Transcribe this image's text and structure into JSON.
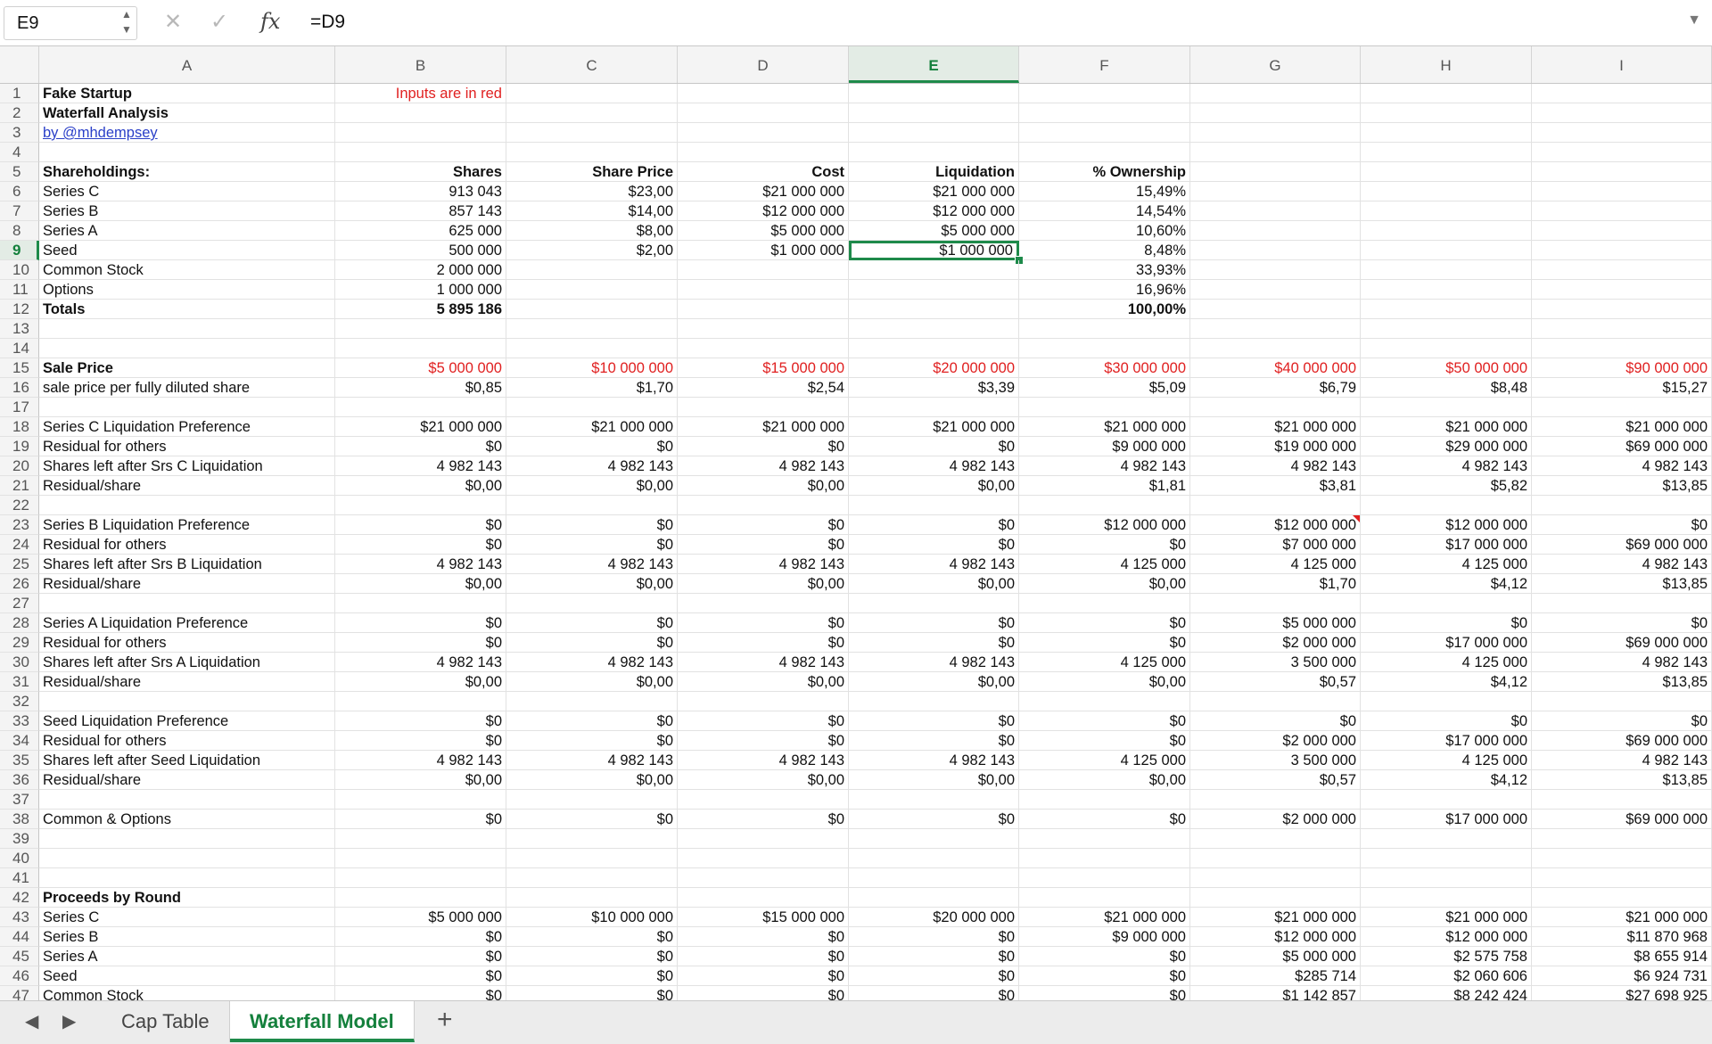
{
  "formula_bar": {
    "name_box": "E9",
    "formula": "=D9",
    "cancel_icon": "close-icon",
    "confirm_icon": "check-icon",
    "function_icon": "fx-icon"
  },
  "columns": [
    "A",
    "B",
    "C",
    "D",
    "E",
    "F",
    "G",
    "H",
    "I"
  ],
  "selected_column": "E",
  "selected_row": "9",
  "colors": {
    "accent": "#1e8a4a",
    "input_red": "#e02020",
    "link_blue": "#2a3fc8"
  },
  "rows": [
    {
      "n": "1",
      "A": "Fake Startup",
      "A_style": "bold",
      "B": "Inputs are in red",
      "B_style": "red"
    },
    {
      "n": "2",
      "A": "Waterfall Analysis",
      "A_style": "bold"
    },
    {
      "n": "3",
      "A": "by @mhdempsey",
      "A_style": "link"
    },
    {
      "n": "4"
    },
    {
      "n": "5",
      "A": "Shareholdings:",
      "A_style": "bold",
      "B": "Shares",
      "B_style": "bold",
      "C": "Share Price",
      "C_style": "bold",
      "D": "Cost",
      "D_style": "bold",
      "E": "Liquidation",
      "E_style": "bold",
      "F": "% Ownership",
      "F_style": "bold"
    },
    {
      "n": "6",
      "A": "Series C",
      "B": "913 043",
      "C": "$23,00",
      "D": "$21 000 000",
      "E": "$21 000 000",
      "F": "15,49%"
    },
    {
      "n": "7",
      "A": "Series B",
      "B": "857 143",
      "C": "$14,00",
      "D": "$12 000 000",
      "E": "$12 000 000",
      "F": "14,54%"
    },
    {
      "n": "8",
      "A": "Series A",
      "B": "625 000",
      "C": "$8,00",
      "D": "$5 000 000",
      "E": "$5 000 000",
      "F": "10,60%"
    },
    {
      "n": "9",
      "A": "Seed",
      "B": "500 000",
      "C": "$2,00",
      "D": "$1 000 000",
      "E": "$1 000 000",
      "F": "8,48%"
    },
    {
      "n": "10",
      "A": "Common Stock",
      "B": "2 000 000",
      "F": "33,93%"
    },
    {
      "n": "11",
      "A": "Options",
      "B": "1 000 000",
      "F": "16,96%"
    },
    {
      "n": "12",
      "A": "Totals",
      "A_style": "bold",
      "B": "5 895 186",
      "B_style": "bold",
      "F": "100,00%",
      "F_style": "bold"
    },
    {
      "n": "13"
    },
    {
      "n": "14"
    },
    {
      "n": "15",
      "A": "Sale Price",
      "A_style": "bold",
      "B": "$5 000 000",
      "C": "$10 000 000",
      "D": "$15 000 000",
      "E": "$20 000 000",
      "F": "$30 000 000",
      "G": "$40 000 000",
      "H": "$50 000 000",
      "I": "$90 000 000",
      "num_style": "red"
    },
    {
      "n": "16",
      "A": "sale price per fully diluted share",
      "B": "$0,85",
      "C": "$1,70",
      "D": "$2,54",
      "E": "$3,39",
      "F": "$5,09",
      "G": "$6,79",
      "H": "$8,48",
      "I": "$15,27"
    },
    {
      "n": "17"
    },
    {
      "n": "18",
      "A": "Series C Liquidation Preference",
      "B": "$21 000 000",
      "C": "$21 000 000",
      "D": "$21 000 000",
      "E": "$21 000 000",
      "F": "$21 000 000",
      "G": "$21 000 000",
      "H": "$21 000 000",
      "I": "$21 000 000"
    },
    {
      "n": "19",
      "A": "Residual for others",
      "B": "$0",
      "C": "$0",
      "D": "$0",
      "E": "$0",
      "F": "$9 000 000",
      "G": "$19 000 000",
      "H": "$29 000 000",
      "I": "$69 000 000"
    },
    {
      "n": "20",
      "A": "Shares left after Srs C Liquidation",
      "B": "4 982 143",
      "C": "4 982 143",
      "D": "4 982 143",
      "E": "4 982 143",
      "F": "4 982 143",
      "G": "4 982 143",
      "H": "4 982 143",
      "I": "4 982 143"
    },
    {
      "n": "21",
      "A": "Residual/share",
      "B": "$0,00",
      "C": "$0,00",
      "D": "$0,00",
      "E": "$0,00",
      "F": "$1,81",
      "G": "$3,81",
      "H": "$5,82",
      "I": "$13,85"
    },
    {
      "n": "22"
    },
    {
      "n": "23",
      "A": "Series B Liquidation Preference",
      "B": "$0",
      "C": "$0",
      "D": "$0",
      "E": "$0",
      "F": "$12 000 000",
      "G": "$12 000 000",
      "H": "$12 000 000",
      "I": "$0",
      "comment": "G"
    },
    {
      "n": "24",
      "A": "Residual for others",
      "B": "$0",
      "C": "$0",
      "D": "$0",
      "E": "$0",
      "F": "$0",
      "G": "$7 000 000",
      "H": "$17 000 000",
      "I": "$69 000 000"
    },
    {
      "n": "25",
      "A": "Shares left after Srs B Liquidation",
      "B": "4 982 143",
      "C": "4 982 143",
      "D": "4 982 143",
      "E": "4 982 143",
      "F": "4 125 000",
      "G": "4 125 000",
      "H": "4 125 000",
      "I": "4 982 143"
    },
    {
      "n": "26",
      "A": "Residual/share",
      "B": "$0,00",
      "C": "$0,00",
      "D": "$0,00",
      "E": "$0,00",
      "F": "$0,00",
      "G": "$1,70",
      "H": "$4,12",
      "I": "$13,85"
    },
    {
      "n": "27"
    },
    {
      "n": "28",
      "A": "Series A Liquidation Preference",
      "B": "$0",
      "C": "$0",
      "D": "$0",
      "E": "$0",
      "F": "$0",
      "G": "$5 000 000",
      "H": "$0",
      "I": "$0"
    },
    {
      "n": "29",
      "A": "Residual for others",
      "B": "$0",
      "C": "$0",
      "D": "$0",
      "E": "$0",
      "F": "$0",
      "G": "$2 000 000",
      "H": "$17 000 000",
      "I": "$69 000 000"
    },
    {
      "n": "30",
      "A": "Shares left after Srs A Liquidation",
      "B": "4 982 143",
      "C": "4 982 143",
      "D": "4 982 143",
      "E": "4 982 143",
      "F": "4 125 000",
      "G": "3 500 000",
      "H": "4 125 000",
      "I": "4 982 143"
    },
    {
      "n": "31",
      "A": "Residual/share",
      "B": "$0,00",
      "C": "$0,00",
      "D": "$0,00",
      "E": "$0,00",
      "F": "$0,00",
      "G": "$0,57",
      "H": "$4,12",
      "I": "$13,85"
    },
    {
      "n": "32"
    },
    {
      "n": "33",
      "A": "Seed Liquidation Preference",
      "B": "$0",
      "C": "$0",
      "D": "$0",
      "E": "$0",
      "F": "$0",
      "G": "$0",
      "H": "$0",
      "I": "$0"
    },
    {
      "n": "34",
      "A": "Residual for others",
      "B": "$0",
      "C": "$0",
      "D": "$0",
      "E": "$0",
      "F": "$0",
      "G": "$2 000 000",
      "H": "$17 000 000",
      "I": "$69 000 000"
    },
    {
      "n": "35",
      "A": "Shares left after Seed Liquidation",
      "B": "4 982 143",
      "C": "4 982 143",
      "D": "4 982 143",
      "E": "4 982 143",
      "F": "4 125 000",
      "G": "3 500 000",
      "H": "4 125 000",
      "I": "4 982 143"
    },
    {
      "n": "36",
      "A": "Residual/share",
      "B": "$0,00",
      "C": "$0,00",
      "D": "$0,00",
      "E": "$0,00",
      "F": "$0,00",
      "G": "$0,57",
      "H": "$4,12",
      "I": "$13,85"
    },
    {
      "n": "37"
    },
    {
      "n": "38",
      "A": "Common & Options",
      "B": "$0",
      "C": "$0",
      "D": "$0",
      "E": "$0",
      "F": "$0",
      "G": "$2 000 000",
      "H": "$17 000 000",
      "I": "$69 000 000"
    },
    {
      "n": "39"
    },
    {
      "n": "40"
    },
    {
      "n": "41"
    },
    {
      "n": "42",
      "A": "Proceeds by Round",
      "A_style": "bold"
    },
    {
      "n": "43",
      "A": "Series C",
      "B": "$5 000 000",
      "C": "$10 000 000",
      "D": "$15 000 000",
      "E": "$20 000 000",
      "F": "$21 000 000",
      "G": "$21 000 000",
      "H": "$21 000 000",
      "I": "$21 000 000"
    },
    {
      "n": "44",
      "A": "Series B",
      "B": "$0",
      "C": "$0",
      "D": "$0",
      "E": "$0",
      "F": "$9 000 000",
      "G": "$12 000 000",
      "H": "$12 000 000",
      "I": "$11 870 968"
    },
    {
      "n": "45",
      "A": "Series A",
      "B": "$0",
      "C": "$0",
      "D": "$0",
      "E": "$0",
      "F": "$0",
      "G": "$5 000 000",
      "H": "$2 575 758",
      "I": "$8 655 914"
    },
    {
      "n": "46",
      "A": "Seed",
      "B": "$0",
      "C": "$0",
      "D": "$0",
      "E": "$0",
      "F": "$0",
      "G": "$285 714",
      "H": "$2 060 606",
      "I": "$6 924 731"
    },
    {
      "n": "47",
      "A": "Common Stock",
      "B": "$0",
      "C": "$0",
      "D": "$0",
      "E": "$0",
      "F": "$0",
      "G": "$1 142 857",
      "H": "$8 242 424",
      "I": "$27 698 925"
    }
  ],
  "sheet_tabs": [
    {
      "label": "Cap Table",
      "active": false
    },
    {
      "label": "Waterfall Model",
      "active": true
    }
  ],
  "add_sheet_label": "+"
}
